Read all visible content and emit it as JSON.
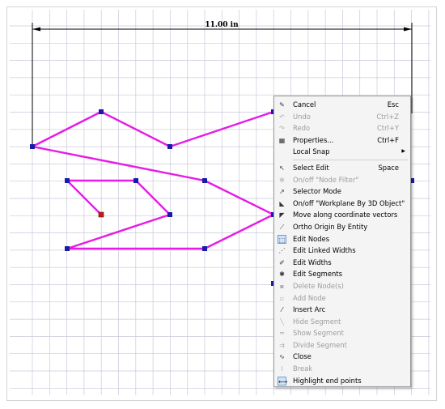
{
  "dimension": {
    "label": "11.00 in"
  },
  "colors": {
    "grid_line": "#c9c9dc",
    "shape_stroke": "#e61be6",
    "node_fill": "#1a1aa8",
    "node_selected_fill": "#c41a1a",
    "menu_bg": "#f4f4f4"
  },
  "context_menu": {
    "items": [
      {
        "label": "Cancel",
        "shortcut": "Esc",
        "icon": "cancel-icon",
        "glyph": "✎",
        "disabled": false
      },
      {
        "label": "Undo",
        "shortcut": "Ctrl+Z",
        "icon": "undo-icon",
        "glyph": "↶",
        "disabled": true
      },
      {
        "label": "Redo",
        "shortcut": "Ctrl+Y",
        "icon": "redo-icon",
        "glyph": "↷",
        "disabled": true
      },
      {
        "label": "Properties...",
        "shortcut": "Ctrl+F",
        "icon": "properties-icon",
        "glyph": "▦",
        "disabled": false
      },
      {
        "label": "Local Snap",
        "shortcut": "",
        "icon": "",
        "glyph": "",
        "submenu": true,
        "disabled": false
      },
      {
        "separator": true
      },
      {
        "label": "Select Edit",
        "shortcut": "Space",
        "icon": "select-arrow-icon",
        "glyph": "↖",
        "disabled": false
      },
      {
        "label": "On/off \"Node Filter\"",
        "shortcut": "",
        "icon": "node-filter-icon",
        "glyph": "✻",
        "disabled": true
      },
      {
        "label": "Selector Mode",
        "shortcut": "",
        "icon": "selector-mode-icon",
        "glyph": "↗",
        "disabled": false
      },
      {
        "label": "On/off \"Workplane By 3D Object\"",
        "shortcut": "",
        "icon": "workplane-icon",
        "glyph": "◣",
        "disabled": false
      },
      {
        "label": "Move along coordinate vectors",
        "shortcut": "",
        "icon": "move-vectors-icon",
        "glyph": "◤",
        "disabled": false
      },
      {
        "label": "Ortho Origin By Entity",
        "shortcut": "",
        "icon": "ortho-origin-icon",
        "glyph": "⟋",
        "disabled": false
      },
      {
        "label": "Edit Nodes",
        "shortcut": "",
        "icon": "edit-nodes-icon",
        "glyph": "⬚",
        "boxed": true,
        "disabled": false
      },
      {
        "label": "Edit Linked Widths",
        "shortcut": "",
        "icon": "edit-linked-widths-icon",
        "glyph": "⋰",
        "disabled": false
      },
      {
        "label": "Edit Widths",
        "shortcut": "",
        "icon": "edit-widths-icon",
        "glyph": "✐",
        "disabled": false
      },
      {
        "label": "Edit Segments",
        "shortcut": "",
        "icon": "edit-segments-icon",
        "glyph": "✱",
        "disabled": false
      },
      {
        "label": "Delete Node(s)",
        "shortcut": "",
        "icon": "delete-node-icon",
        "glyph": "▪",
        "disabled": true
      },
      {
        "label": "Add Node",
        "shortcut": "",
        "icon": "add-node-icon",
        "glyph": "▫",
        "disabled": true
      },
      {
        "label": "Insert Arc",
        "shortcut": "",
        "icon": "insert-arc-icon",
        "glyph": "⁄",
        "disabled": false
      },
      {
        "label": "Hide Segment",
        "shortcut": "",
        "icon": "hide-segment-icon",
        "glyph": "╲",
        "disabled": true
      },
      {
        "label": "Show Segment",
        "shortcut": "",
        "icon": "show-segment-icon",
        "glyph": "═",
        "disabled": true
      },
      {
        "label": "Divide Segment",
        "shortcut": "",
        "icon": "divide-segment-icon",
        "glyph": "⇉",
        "disabled": true
      },
      {
        "label": "Close",
        "shortcut": "",
        "icon": "close-contour-icon",
        "glyph": "∿",
        "disabled": false
      },
      {
        "label": "Break",
        "shortcut": "",
        "icon": "break-icon",
        "glyph": "⌇",
        "disabled": true
      },
      {
        "label": "Highlight end points",
        "shortcut": "",
        "icon": "highlight-endpoints-icon",
        "glyph": "⟷",
        "boxed": true,
        "disabled": false
      }
    ]
  }
}
